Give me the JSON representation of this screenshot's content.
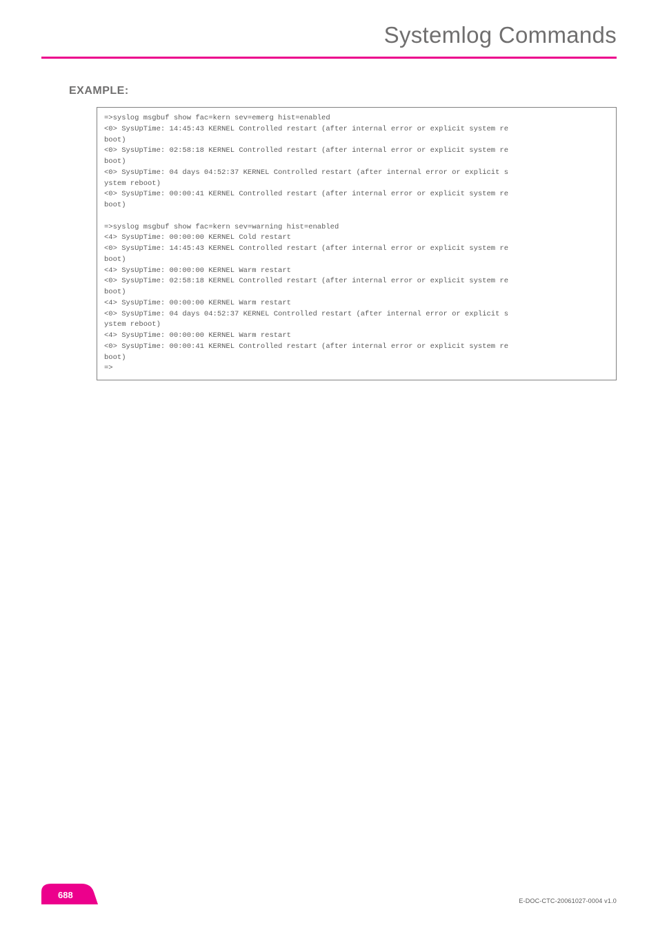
{
  "header": {
    "title": "Systemlog Commands"
  },
  "section": {
    "heading": "EXAMPLE:"
  },
  "code_block": "=>syslog msgbuf show fac=kern sev=emerg hist=enabled\n<0> SysUpTime: 14:45:43 KERNEL Controlled restart (after internal error or explicit system re\nboot)\n<0> SysUpTime: 02:58:18 KERNEL Controlled restart (after internal error or explicit system re\nboot)\n<0> SysUpTime: 04 days 04:52:37 KERNEL Controlled restart (after internal error or explicit s\nystem reboot)\n<0> SysUpTime: 00:00:41 KERNEL Controlled restart (after internal error or explicit system re\nboot)\n\n=>syslog msgbuf show fac=kern sev=warning hist=enabled\n<4> SysUpTime: 00:00:00 KERNEL Cold restart\n<0> SysUpTime: 14:45:43 KERNEL Controlled restart (after internal error or explicit system re\nboot)\n<4> SysUpTime: 00:00:00 KERNEL Warm restart\n<0> SysUpTime: 02:58:18 KERNEL Controlled restart (after internal error or explicit system re\nboot)\n<4> SysUpTime: 00:00:00 KERNEL Warm restart\n<0> SysUpTime: 04 days 04:52:37 KERNEL Controlled restart (after internal error or explicit s\nystem reboot)\n<4> SysUpTime: 00:00:00 KERNEL Warm restart\n<0> SysUpTime: 00:00:41 KERNEL Controlled restart (after internal error or explicit system re\nboot)\n=>",
  "footer": {
    "page_number": "688",
    "doc_id": "E-DOC-CTC-20061027-0004 v1.0"
  },
  "colors": {
    "accent": "#ec008c",
    "text_gray": "#706f6f",
    "code_gray": "#5a5a5a"
  }
}
